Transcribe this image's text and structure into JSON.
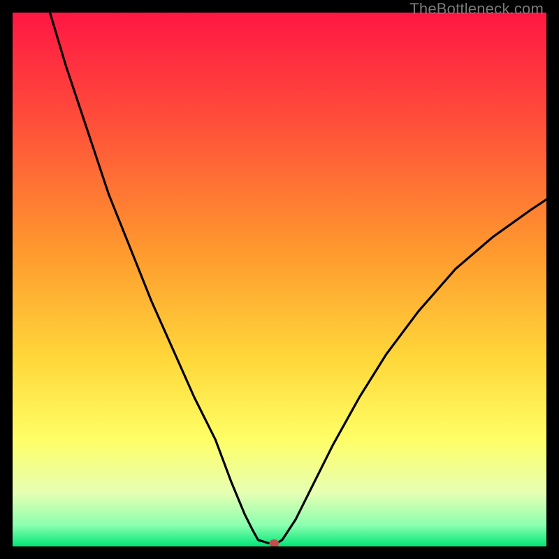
{
  "watermark": "TheBottleneck.com",
  "chart_data": {
    "type": "line",
    "title": "",
    "xlabel": "",
    "ylabel": "",
    "xlim": [
      0,
      100
    ],
    "ylim": [
      0,
      100
    ],
    "grid": false,
    "legend": false,
    "gradient_stops": [
      {
        "offset": 0,
        "color": "#ff1744"
      },
      {
        "offset": 20,
        "color": "#ff4d3a"
      },
      {
        "offset": 45,
        "color": "#ff9a2e"
      },
      {
        "offset": 65,
        "color": "#ffd83a"
      },
      {
        "offset": 80,
        "color": "#ffff66"
      },
      {
        "offset": 90,
        "color": "#e6ffb3"
      },
      {
        "offset": 96,
        "color": "#8cffb0"
      },
      {
        "offset": 100,
        "color": "#00e676"
      }
    ],
    "curve": {
      "x": [
        7,
        10,
        14,
        18,
        22,
        26,
        30,
        34,
        38,
        41,
        43.5,
        45,
        46,
        48,
        49.5,
        50.5,
        53,
        56,
        60,
        65,
        70,
        76,
        83,
        90,
        97,
        100
      ],
      "y": [
        100,
        90,
        78,
        66,
        56,
        46,
        37,
        28,
        20,
        12,
        6,
        3,
        1.2,
        0.6,
        0.6,
        1.2,
        5,
        11,
        19,
        28,
        36,
        44,
        52,
        58,
        63,
        65
      ]
    },
    "marker": {
      "x": 49,
      "y": 0.6,
      "color": "#c0504d"
    }
  }
}
